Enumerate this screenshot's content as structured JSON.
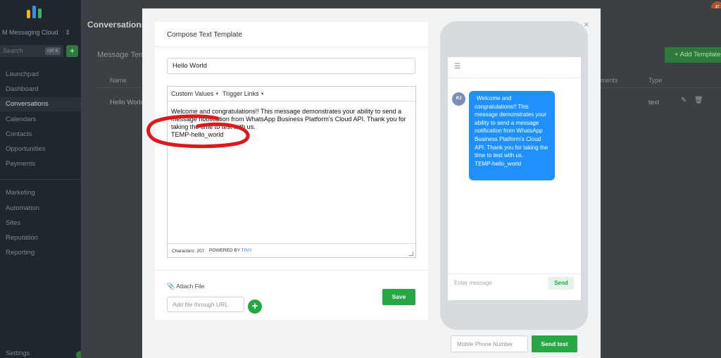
{
  "app": {
    "account_name": "M Messaging Cloud",
    "search_placeholder": "Search",
    "search_shortcut": "ctrl K",
    "user_initial": "E"
  },
  "sidebar": {
    "items": [
      {
        "label": "Launchpad"
      },
      {
        "label": "Dashboard"
      },
      {
        "label": "Conversations",
        "active": true
      },
      {
        "label": "Calendars"
      },
      {
        "label": "Contacts"
      },
      {
        "label": "Opportunities"
      },
      {
        "label": "Payments"
      },
      {
        "label": "Marketing"
      },
      {
        "label": "Automation"
      },
      {
        "label": "Sites"
      },
      {
        "label": "Reputation"
      },
      {
        "label": "Reporting"
      },
      {
        "label": "Settings"
      }
    ]
  },
  "background": {
    "page_title": "Conversations",
    "section_title": "Message Temp",
    "add_template_label": "+ Add Template",
    "columns": {
      "name": "Name",
      "comments": "ments",
      "type": "Type"
    },
    "row": {
      "name": "Hello World",
      "type": "text"
    }
  },
  "modal": {
    "title": "Compose Text Template",
    "close_label": "×",
    "template_name": "Hello World",
    "toolbar": {
      "custom_values": "Custom Values",
      "trigger_links": "Trigger Links"
    },
    "body": {
      "line1": "Welcome and congratulations!! This message demonstrates your ability to send a message notification from WhatsApp Business Platform's Cloud API. Thank you for taking the time to test with us.",
      "line2": "TEMP-hello_world"
    },
    "status": {
      "characters": "Characters: 207",
      "powered_by": "POWERED BY",
      "powered_brand": "TINY"
    },
    "attach_label": "Attach File",
    "url_placeholder": "Add file through URL",
    "add_label": "+",
    "save_label": "Save"
  },
  "preview": {
    "avatar_initials": "RJ",
    "bubble_line1": "Welcome and congratulations!! This message demonstrates your ability to send a message notification from WhatsApp Business Platform's Cloud API. Thank you for taking the time to test with us.",
    "bubble_line2": "TEMP-hello_world",
    "message_placeholder": "Enter message",
    "send_label": "Send",
    "phone_placeholder": "Mobile Phone Number",
    "send_test_label": "Send test"
  },
  "colors": {
    "accent_green": "#28a745",
    "bubble_blue": "#1e90ff",
    "annotation_red": "#e0181b"
  }
}
